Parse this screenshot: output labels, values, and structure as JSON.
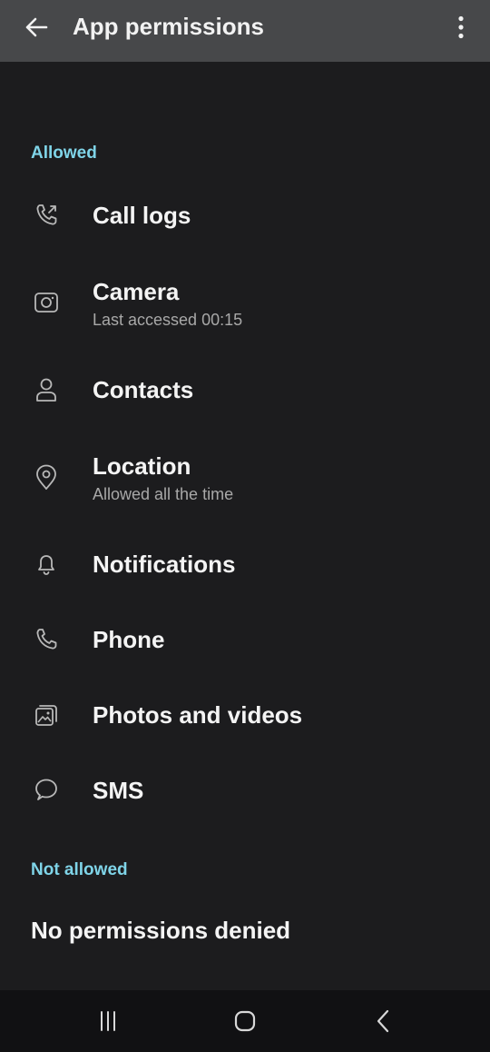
{
  "header": {
    "title": "App permissions",
    "back_icon": "arrow-left-icon",
    "more_icon": "more-vertical-icon"
  },
  "allowed": {
    "label": "Allowed",
    "items": [
      {
        "title": "Call logs",
        "subtitle": "",
        "icon": "call-log-icon"
      },
      {
        "title": "Camera",
        "subtitle": "Last accessed 00:15",
        "icon": "camera-icon"
      },
      {
        "title": "Contacts",
        "subtitle": "",
        "icon": "contacts-icon"
      },
      {
        "title": "Location",
        "subtitle": "Allowed all the time",
        "icon": "location-icon"
      },
      {
        "title": "Notifications",
        "subtitle": "",
        "icon": "bell-icon"
      },
      {
        "title": "Phone",
        "subtitle": "",
        "icon": "phone-icon"
      },
      {
        "title": "Photos and videos",
        "subtitle": "",
        "icon": "photos-icon"
      },
      {
        "title": "SMS",
        "subtitle": "",
        "icon": "sms-icon"
      }
    ]
  },
  "not_allowed": {
    "label": "Not allowed",
    "empty_text": "No permissions denied"
  },
  "navbar": {
    "recents_icon": "recents-icon",
    "home_icon": "home-icon",
    "back_icon": "nav-back-icon"
  },
  "colors": {
    "background": "#1c1c1e",
    "appbar": "#47484a",
    "section_accent": "#7fd4e8",
    "subtitle": "#a8a8a8"
  }
}
